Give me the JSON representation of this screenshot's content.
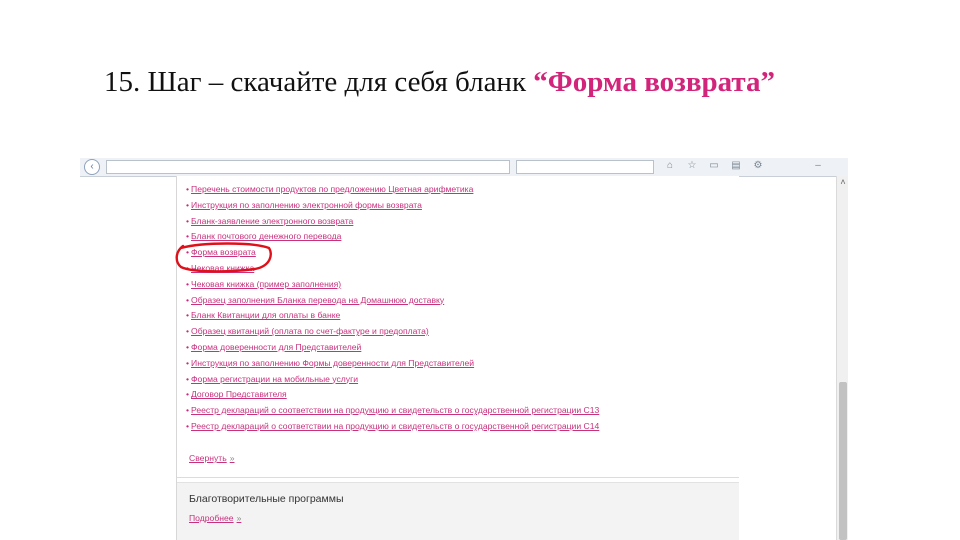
{
  "slide": {
    "title_prefix": "15. Шаг – скачайте для себя бланк ",
    "title_highlight": "“Форма возврата”"
  },
  "colors": {
    "accent": "#d2247a",
    "link": "#c8317d",
    "annotation": "#e0101a"
  },
  "links": [
    "Перечень стоимости продуктов по предложению Цветная арифметика",
    "Инструкция по заполнению электронной формы возврата",
    "Бланк-заявление электронного возврата",
    "Бланк почтового денежного перевода",
    "Форма возврата",
    "Чековая книжка",
    "Чековая книжка (пример заполнения)",
    "Образец заполнения Бланка перевода на Домашнюю доставку",
    "Бланк Квитанции для оплаты в банке",
    "Образец квитанций (оплата по счет-фактуре и предоплата)",
    "Форма доверенности для Представителей",
    "Инструкция по заполнению Формы доверенности для Представителей",
    "Форма регистрации на мобильные услуги",
    "Договор Представителя",
    "Реестр деклараций о соответствии на продукцию и свидетельств о государственной регистрации С13",
    "Реестр деклараций о соответствии на продукцию и свидетельств о государственной регистрации С14"
  ],
  "collapse_label": "Свернуть",
  "charity": {
    "title": "Благотворительные программы",
    "more": "Подробнее"
  },
  "icons": [
    "back-icon",
    "scroll-up-icon",
    "expand-arrow-icon"
  ]
}
